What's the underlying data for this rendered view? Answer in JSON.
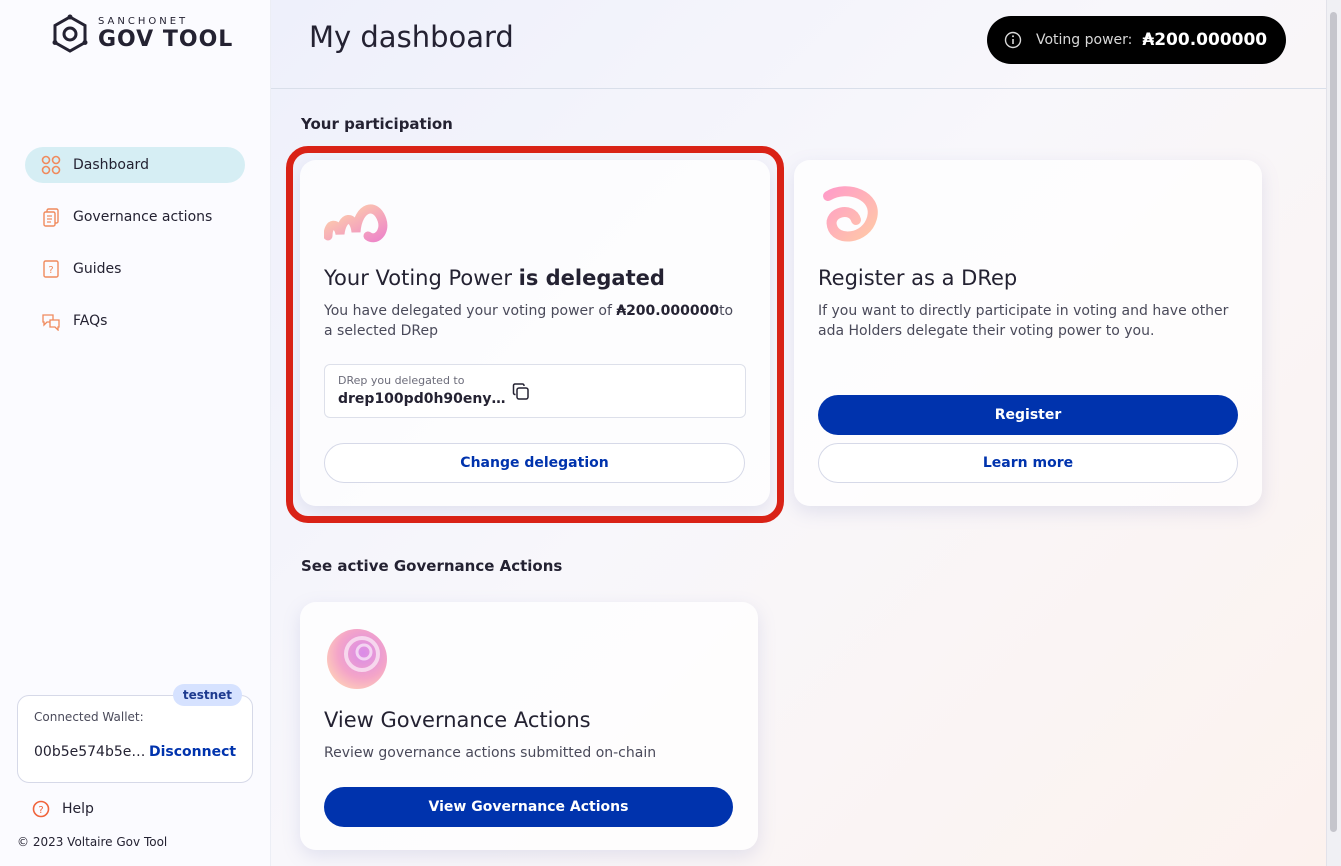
{
  "sidebar": {
    "logo": {
      "small": "SANCHONET",
      "big": "GOV TOOL"
    },
    "nav": [
      {
        "label": "Dashboard",
        "icon": "dashboard-icon",
        "active": true
      },
      {
        "label": "Governance actions",
        "icon": "document-icon",
        "active": false
      },
      {
        "label": "Guides",
        "icon": "guide-icon",
        "active": false
      },
      {
        "label": "FAQs",
        "icon": "chat-icon",
        "active": false
      }
    ],
    "wallet": {
      "badge": "testnet",
      "label": "Connected Wallet:",
      "address": "00b5e574b5e…",
      "disconnect": "Disconnect"
    },
    "help": "Help",
    "copyright": "© 2023 Voltaire Gov Tool"
  },
  "header": {
    "title": "My dashboard",
    "voting_power_label": "Voting power:",
    "voting_power_value": "₳200.000000"
  },
  "participation": {
    "section_title": "Your participation",
    "delegated_card": {
      "title_prefix": "Your Voting Power ",
      "title_bold": "is delegated",
      "desc_prefix": "You have delegated your voting power of ",
      "desc_amount": "₳200.000000",
      "desc_suffix": "to a selected DRep",
      "drep_label": "DRep you delegated to",
      "drep_id": "drep100pd0h90eny…",
      "change_button": "Change delegation"
    },
    "register_card": {
      "title": "Register as a DRep",
      "desc": "If you want to directly participate in voting and have other ada Holders delegate their voting power to you.",
      "register_button": "Register",
      "learn_button": "Learn more"
    }
  },
  "governance": {
    "section_title": "See active Governance Actions",
    "card": {
      "title": "View Governance Actions",
      "desc": "Review governance actions submitted on-chain",
      "button": "View Governance Actions"
    }
  },
  "colors": {
    "accent": "#0033ad",
    "highlight": "#d92216",
    "nav_active": "#d6eef4"
  }
}
